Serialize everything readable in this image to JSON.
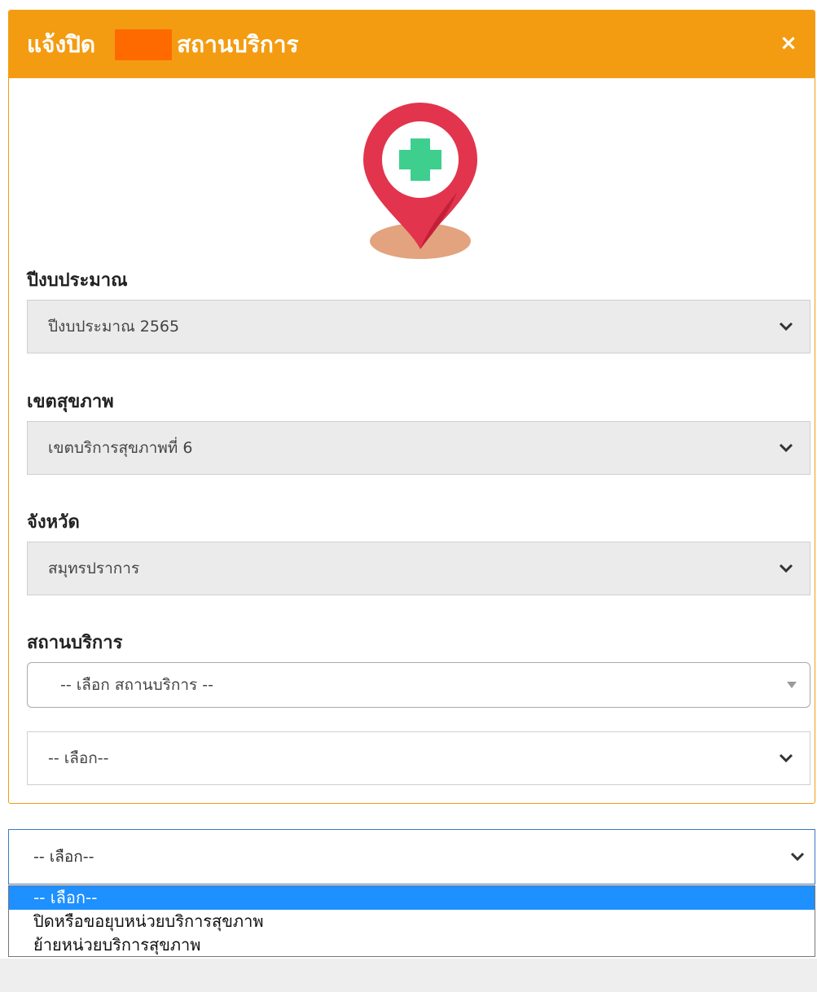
{
  "modal": {
    "title_left": "แจ้งปิด",
    "title_right": "สถานบริการ",
    "close_symbol": "×",
    "header_color": "#f39c12",
    "icon": "location-pin-medical-cross-icon"
  },
  "fields": {
    "fiscal_year": {
      "label": "ปีงบประมาณ",
      "value": "ปีงบประมาณ 2565"
    },
    "health_region": {
      "label": "เขตสุขภาพ",
      "value": "เขตบริการสุขภาพที่ 6"
    },
    "province": {
      "label": "จังหวัด",
      "value": "สมุทรปราการ"
    },
    "facility": {
      "label": "สถานบริการ",
      "value": "-- เลือก สถานบริการ --"
    },
    "action_type": {
      "value": "-- เลือก--"
    }
  },
  "open_select": {
    "value": "-- เลือก--",
    "options": [
      "-- เลือก--",
      "ปิดหรือขอยุบหน่วยบริการสุขภาพ",
      "ย้ายหน่วยบริการสุขภาพ"
    ],
    "selected_index": 0,
    "highlight_color": "#1e90ff"
  }
}
